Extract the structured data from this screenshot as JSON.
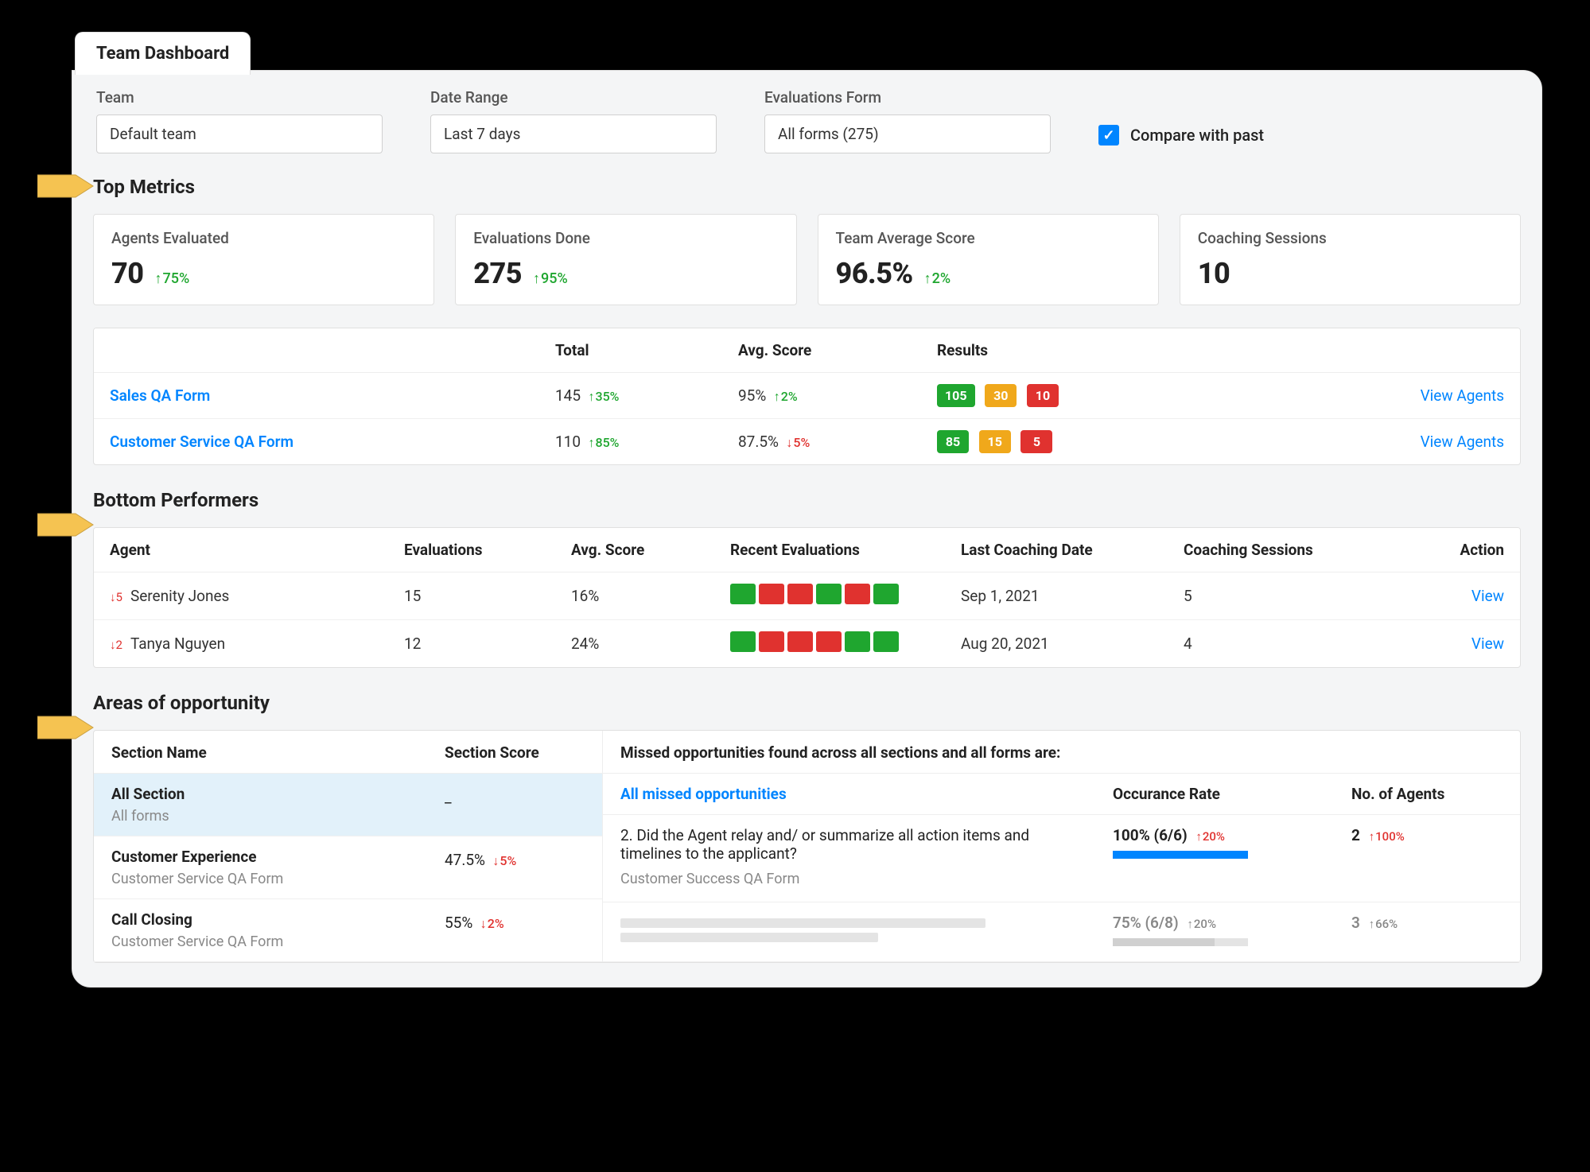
{
  "tab_label": "Team Dashboard",
  "filters": {
    "team_label": "Team",
    "team_value": "Default team",
    "date_label": "Date Range",
    "date_value": "Last 7 days",
    "form_label": "Evaluations Form",
    "form_value": "All forms (275)",
    "compare_label": "Compare with past"
  },
  "sections": {
    "top_metrics": "Top Metrics",
    "bottom_performers": "Bottom Performers",
    "areas": "Areas of opportunity"
  },
  "metric_cards": [
    {
      "label": "Agents Evaluated",
      "value": "70",
      "delta": "75%",
      "dir": "up"
    },
    {
      "label": "Evaluations Done",
      "value": "275",
      "delta": "95%",
      "dir": "up"
    },
    {
      "label": "Team Average Score",
      "value": "96.5%",
      "delta": "2%",
      "dir": "up"
    },
    {
      "label": "Coaching Sessions",
      "value": "10",
      "delta": "",
      "dir": ""
    }
  ],
  "forms_table": {
    "headers": {
      "total": "Total",
      "avg": "Avg. Score",
      "results": "Results"
    },
    "action_label": "View Agents",
    "rows": [
      {
        "name": "Sales QA Form",
        "total": "145",
        "total_delta": "35%",
        "total_dir": "up",
        "avg": "95%",
        "avg_delta": "2%",
        "avg_dir": "up",
        "green": "105",
        "yellow": "30",
        "red": "10"
      },
      {
        "name": "Customer Service QA Form",
        "total": "110",
        "total_delta": "85%",
        "total_dir": "up",
        "avg": "87.5%",
        "avg_delta": "5%",
        "avg_dir": "down",
        "green": "85",
        "yellow": "15",
        "red": "5"
      }
    ]
  },
  "bottom_table": {
    "headers": {
      "agent": "Agent",
      "evals": "Evaluations",
      "avg": "Avg. Score",
      "recent": "Recent Evaluations",
      "last": "Last Coaching Date",
      "sessions": "Coaching Sessions",
      "action": "Action"
    },
    "action_label": "View",
    "rows": [
      {
        "rank_drop": "5",
        "name": "Serenity Jones",
        "evals": "15",
        "avg": "16%",
        "recent": [
          "green",
          "red",
          "red",
          "green",
          "red",
          "green"
        ],
        "last": "Sep 1, 2021",
        "sessions": "5"
      },
      {
        "rank_drop": "2",
        "name": "Tanya Nguyen",
        "evals": "12",
        "avg": "24%",
        "recent": [
          "green",
          "red",
          "red",
          "red",
          "green",
          "green"
        ],
        "last": "Aug 20, 2021",
        "sessions": "4"
      }
    ]
  },
  "areas_left": {
    "headers": {
      "name": "Section Name",
      "score": "Section Score"
    },
    "rows": [
      {
        "name": "All Section",
        "sub": "All forms",
        "score": "_",
        "delta": "",
        "dir": "",
        "selected": true
      },
      {
        "name": "Customer Experience",
        "sub": "Customer Service QA Form",
        "score": "47.5%",
        "delta": "5%",
        "dir": "down",
        "selected": false
      },
      {
        "name": "Call Closing",
        "sub": "Customer Service QA Form",
        "score": "55%",
        "delta": "2%",
        "dir": "down",
        "selected": false
      }
    ]
  },
  "areas_right": {
    "header": "Missed opportunities found across all sections and all forms are:",
    "columns": {
      "c1": "All missed opportunities",
      "c2": "Occurance Rate",
      "c3": "No. of Agents"
    },
    "rows": [
      {
        "question": "2. Did the Agent relay and/ or summarize all action items and timelines to the applicant?",
        "form": "Customer Success QA Form",
        "rate": "100% (6/6)",
        "rate_delta": "20%",
        "rate_dir": "up",
        "bar_pct": 100,
        "bar_color": "blue",
        "agents": "2",
        "agents_delta": "100%",
        "agents_dir": "up",
        "faded": false
      },
      {
        "question": "",
        "form": "",
        "rate": "75% (6/8)",
        "rate_delta": "20%",
        "rate_dir": "up",
        "bar_pct": 75,
        "bar_color": "grey",
        "agents": "3",
        "agents_delta": "66%",
        "agents_dir": "up",
        "faded": true
      }
    ]
  }
}
